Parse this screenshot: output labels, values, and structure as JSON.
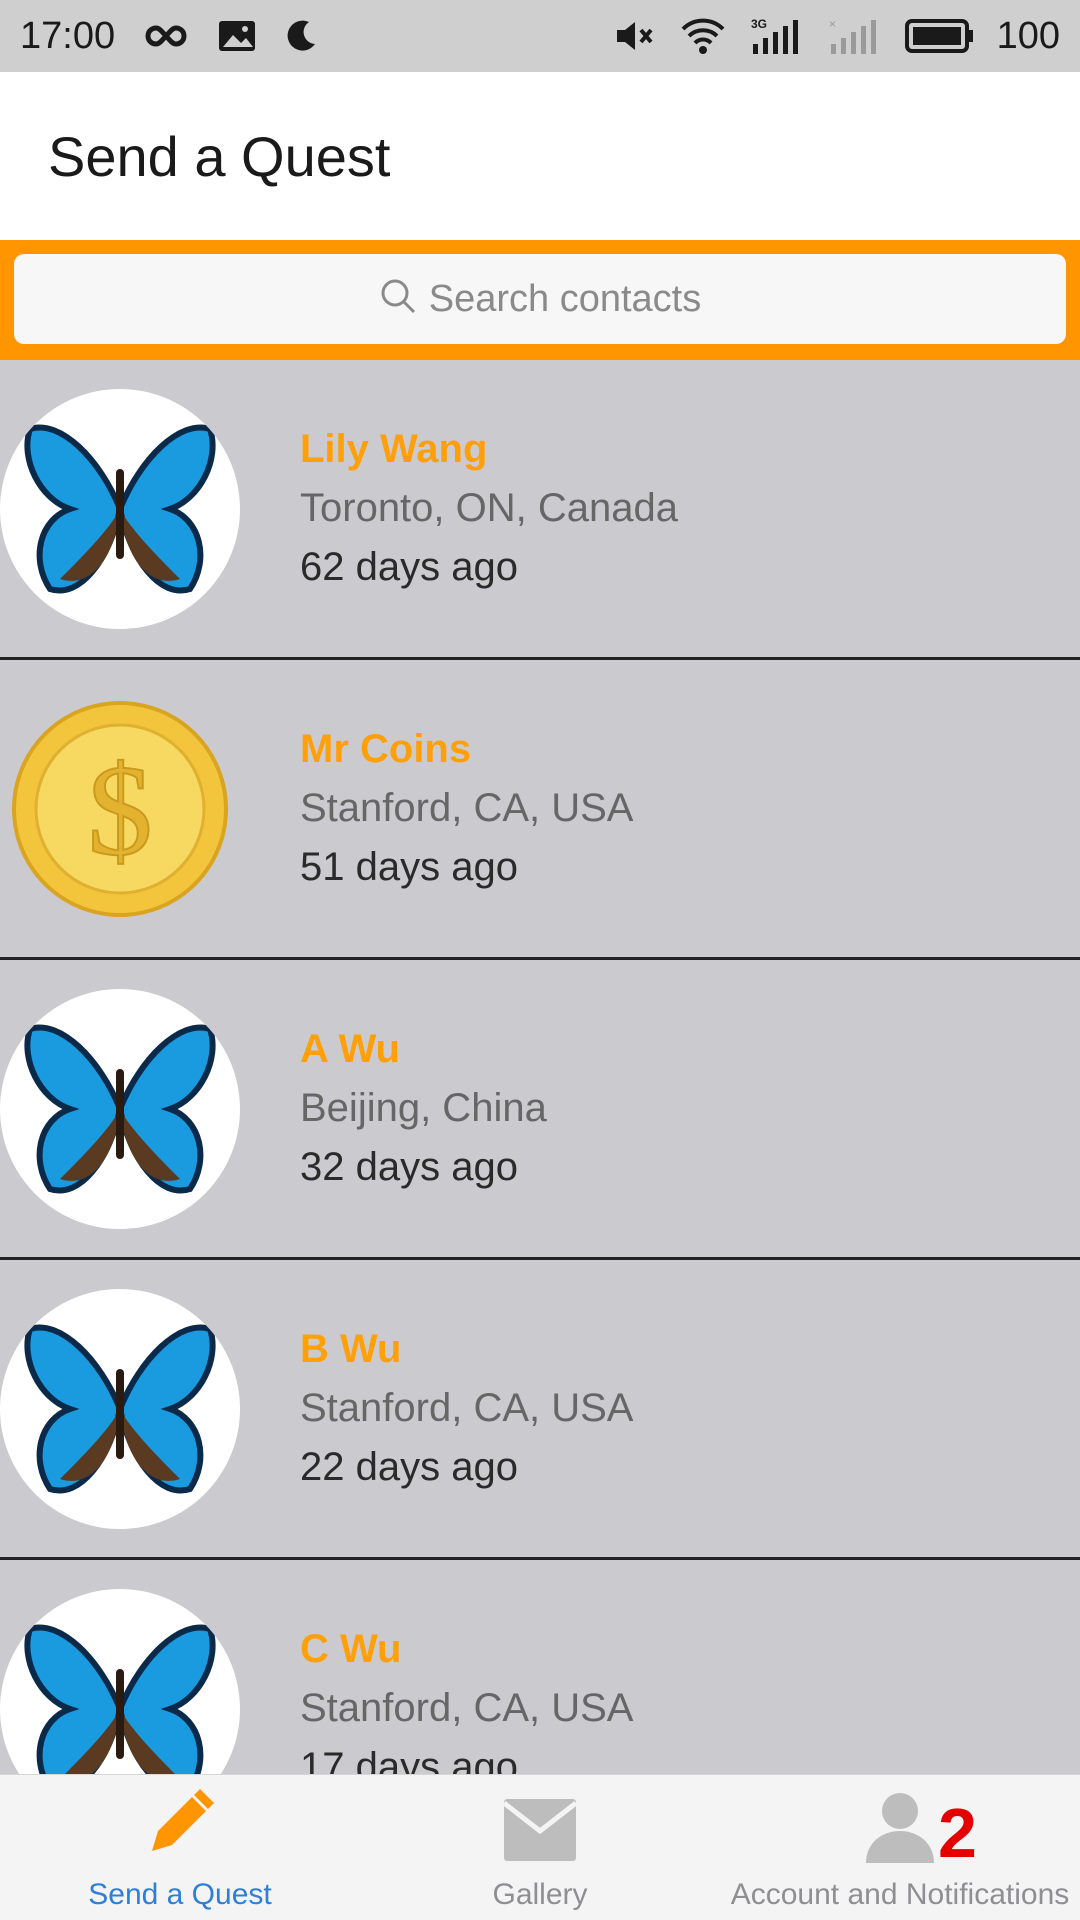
{
  "status_bar": {
    "time": "17:00",
    "battery": "100",
    "icons": [
      "infinity-icon",
      "image-icon",
      "moon-icon",
      "mute-icon",
      "wifi-icon",
      "signal-3g-icon",
      "signal-none-icon",
      "battery-icon"
    ]
  },
  "header": {
    "title": "Send a Quest"
  },
  "search": {
    "placeholder": "Search contacts"
  },
  "contacts": [
    {
      "name": "Lily Wang",
      "location": "Toronto, ON, Canada",
      "time": "62 days ago",
      "avatar": "butterfly"
    },
    {
      "name": "Mr Coins",
      "location": "Stanford, CA, USA",
      "time": "51 days ago",
      "avatar": "coin"
    },
    {
      "name": "A Wu",
      "location": "Beijing, China",
      "time": "32 days ago",
      "avatar": "butterfly"
    },
    {
      "name": "B Wu",
      "location": "Stanford, CA, USA",
      "time": "22 days ago",
      "avatar": "butterfly"
    },
    {
      "name": "C Wu",
      "location": "Stanford, CA, USA",
      "time": "17 days ago",
      "avatar": "butterfly"
    }
  ],
  "tabs": [
    {
      "label": "Send a Quest",
      "icon": "pencil-icon",
      "active": true
    },
    {
      "label": "Gallery",
      "icon": "envelope-icon",
      "active": false
    },
    {
      "label": "Account and Notifications",
      "icon": "person-icon",
      "active": false,
      "badge": "2"
    }
  ],
  "colors": {
    "accent": "#ff9500",
    "name": "#ff9f0a",
    "active_tab": "#2f7fd6",
    "badge": "#e50000"
  }
}
